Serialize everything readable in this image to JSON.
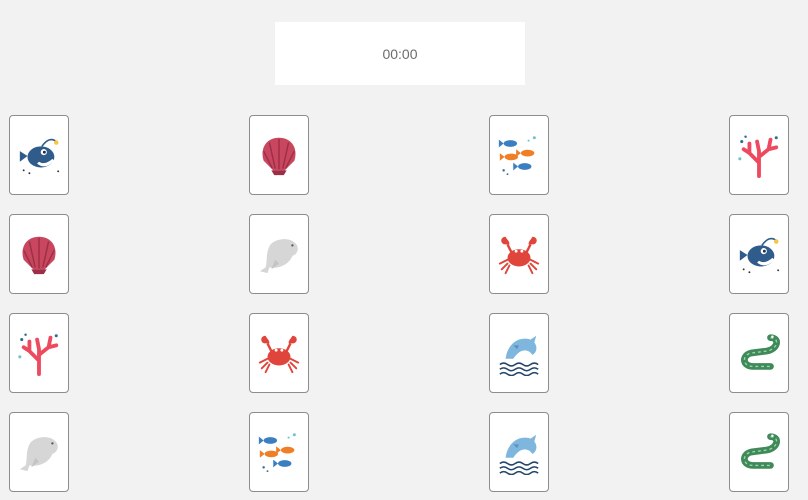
{
  "timer": {
    "display": "00:00"
  },
  "board": {
    "columns": 4,
    "cards": [
      {
        "icon": "anglerfish-icon"
      },
      {
        "icon": "seashell-icon"
      },
      {
        "icon": "fish-school-icon"
      },
      {
        "icon": "coral-icon"
      },
      {
        "icon": "seashell-icon"
      },
      {
        "icon": "beluga-whale-icon"
      },
      {
        "icon": "crab-icon"
      },
      {
        "icon": "anglerfish-icon"
      },
      {
        "icon": "coral-icon"
      },
      {
        "icon": "crab-icon"
      },
      {
        "icon": "dolphin-icon"
      },
      {
        "icon": "eel-icon"
      },
      {
        "icon": "beluga-whale-icon"
      },
      {
        "icon": "fish-school-icon"
      },
      {
        "icon": "dolphin-icon"
      },
      {
        "icon": "eel-icon"
      }
    ]
  },
  "colors": {
    "background": "#f2f2f2",
    "card_border": "#8d8d8d",
    "anglerfish": "#2f5c8a",
    "seashell": "#c9465f",
    "coral": "#ee4a5f",
    "crab": "#e0453b",
    "dolphin": "#7fb6dd",
    "eel": "#3f8a5a",
    "beluga": "#d6d6d6"
  }
}
